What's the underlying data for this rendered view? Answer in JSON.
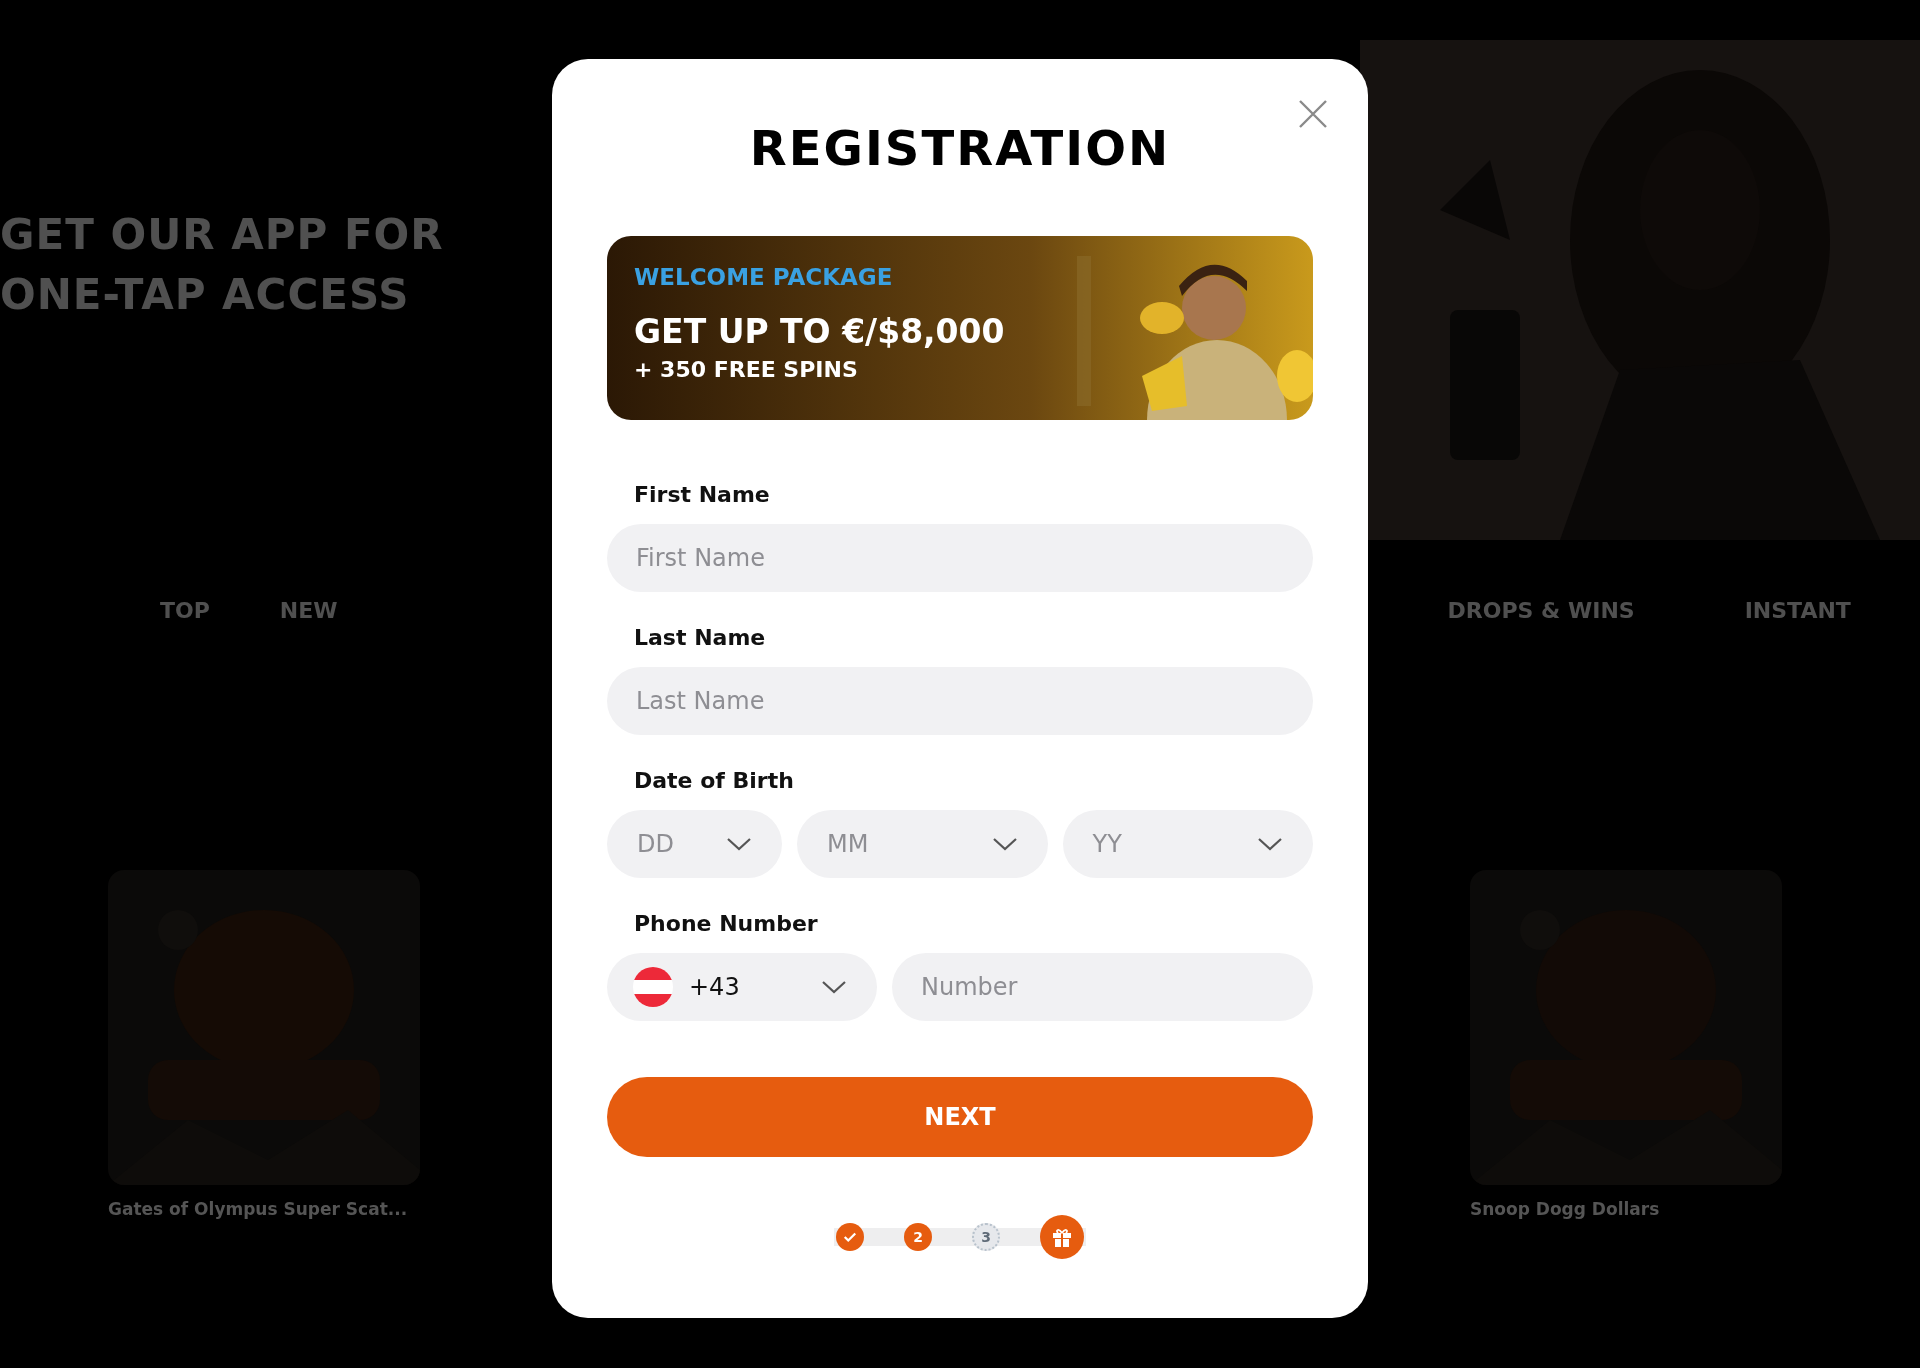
{
  "background": {
    "headline": [
      "GET OUR APP FOR",
      "ONE-TAP ACCESS"
    ],
    "nav": [
      {
        "label": "TOP"
      },
      {
        "label": "NEW"
      },
      {
        "label": "DROPS & WINS"
      },
      {
        "label": "INSTANT"
      }
    ],
    "games": [
      {
        "title": "Gates of Olympus Super Scat..."
      },
      {
        "title": "Snoop Dogg Dollars"
      }
    ]
  },
  "dialog": {
    "title": "REGISTRATION",
    "banner": {
      "eyebrow": "WELCOME PACKAGE",
      "headline": "GET UP TO €/$8,000",
      "subline": "+ 350 FREE SPINS"
    },
    "fields": [
      {
        "label": "First Name",
        "placeholder": "First Name"
      },
      {
        "label": "Last Name",
        "placeholder": "Last Name"
      }
    ],
    "date_of_birth": {
      "label": "Date of Birth",
      "selects": [
        {
          "placeholder": "DD"
        },
        {
          "placeholder": "MM"
        },
        {
          "placeholder": "YY"
        }
      ]
    },
    "phone": {
      "label": "Phone Number",
      "country_code": "+43",
      "placeholder": "Number"
    },
    "submit": "NEXT",
    "steps": [
      {
        "kind": "done"
      },
      {
        "kind": "current",
        "label": "2"
      },
      {
        "kind": "pending",
        "label": "3"
      },
      {
        "kind": "gift"
      }
    ]
  }
}
